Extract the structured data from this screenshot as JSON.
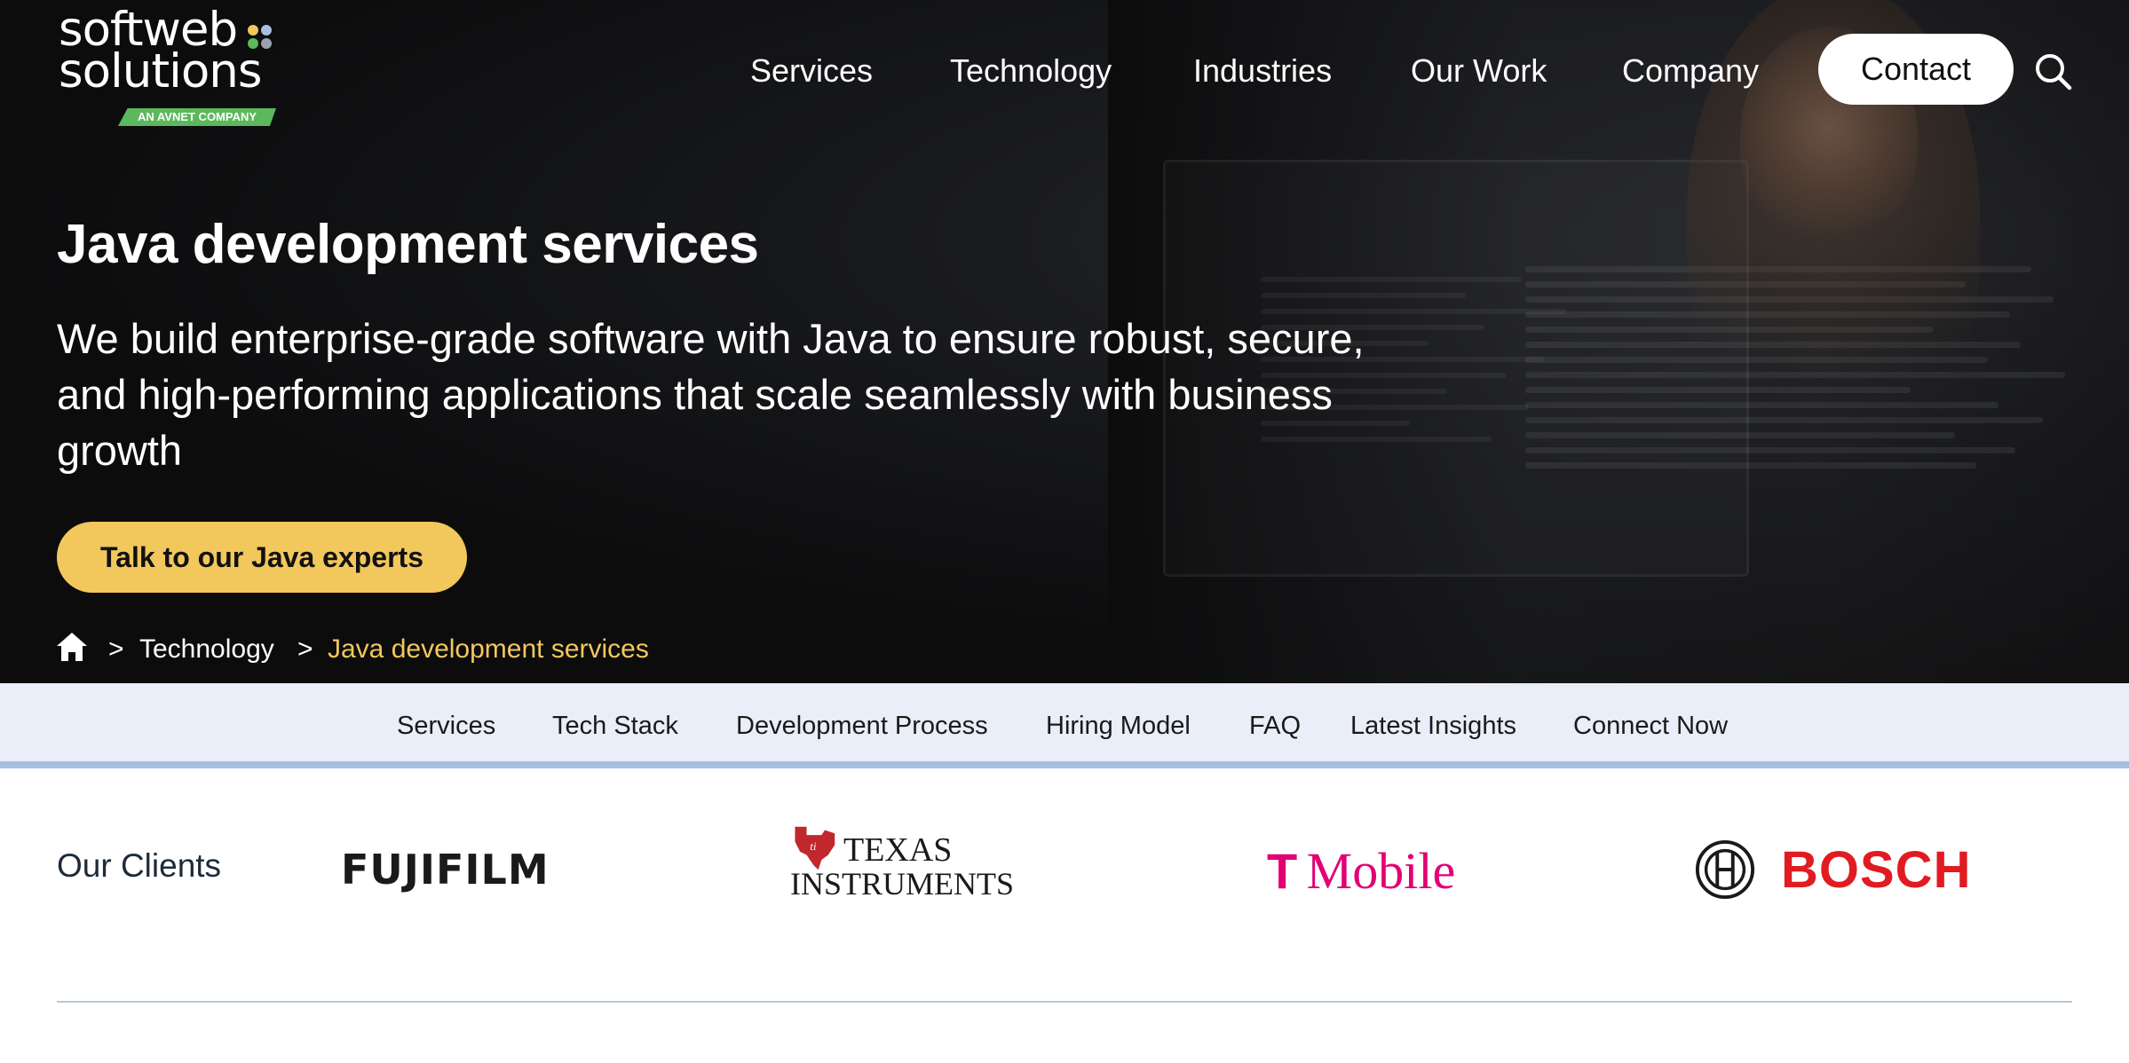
{
  "brand": {
    "logo_line1": "softweb",
    "logo_line2": "solutions",
    "logo_tag": "AN AVNET COMPANY"
  },
  "nav": {
    "items": [
      "Services",
      "Technology",
      "Industries",
      "Our Work",
      "Company"
    ],
    "contact_label": "Contact"
  },
  "hero": {
    "title": "Java development services",
    "subtitle": "We build enterprise-grade software with Java to ensure robust, secure, and high-performing applications that scale seamlessly with business growth",
    "cta_label": "Talk to our Java experts"
  },
  "breadcrumb": {
    "separator": ">",
    "link": "Technology",
    "current": "Java development services"
  },
  "subnav": {
    "items": [
      "Services",
      "Tech Stack",
      "Development Process",
      "Hiring Model",
      "FAQ",
      "Latest Insights",
      "Connect Now"
    ]
  },
  "clients": {
    "label": "Our Clients",
    "logos": {
      "fujifilm": "FUJIFILM",
      "texas_line1": "TEXAS",
      "texas_line2": "INSTRUMENTS",
      "tmobile_t": "T",
      "tmobile_word": "Mobile",
      "bosch": "BOSCH"
    }
  },
  "colors": {
    "accent_yellow": "#f2c75c",
    "subnav_bg": "#e9eef8",
    "subnav_border": "#a7bfe0",
    "tmobile_magenta": "#e20074",
    "bosch_red": "#e11b22",
    "ti_red": "#c0282d",
    "logo_tag_green": "#5cb85c"
  }
}
